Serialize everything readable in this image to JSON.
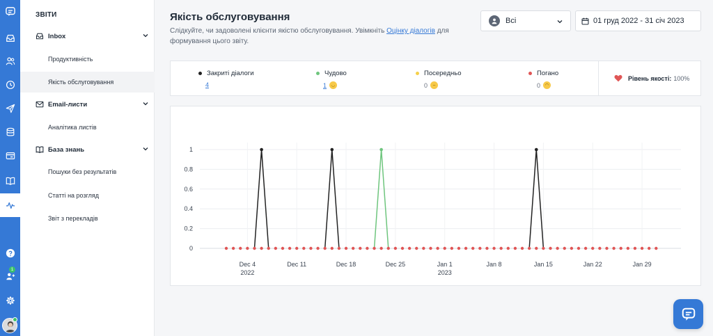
{
  "sidebar": {
    "heading": "ЗВІТИ",
    "groups": [
      {
        "label": "Inbox",
        "items": [
          "Продуктивність",
          "Якість обслуговування"
        ]
      },
      {
        "label": "Email-листи",
        "items": [
          "Аналітика листів"
        ]
      },
      {
        "label": "База знань",
        "items": [
          "Пошуки без результатів",
          "Статті на розгляд",
          "Звіт з перекладів"
        ]
      }
    ],
    "active_item": "Якість обслуговування"
  },
  "rail": {
    "icons": [
      "chat-logo-icon",
      "inbox-icon",
      "contacts-icon",
      "clock-icon",
      "send-icon",
      "database-icon",
      "card-icon",
      "book-icon",
      "reports-icon",
      "help-icon",
      "team-icon",
      "settings-icon"
    ],
    "team_badge": "1"
  },
  "header": {
    "title": "Якість обслуговування",
    "subtitle_before": "Слідкуйте, чи задоволені клієнти якістю обслуговування. Увімкніть ",
    "subtitle_link": "Оцінку діалогів",
    "subtitle_after": " для формування цього звіту."
  },
  "filters": {
    "agent": "Всі",
    "date_range": "01 груд 2022 - 31 січ 2023"
  },
  "stats": {
    "closed_label": "Закриті діалоги",
    "closed_value": "4",
    "great_label": "Чудово",
    "great_value": "1",
    "average_label": "Посередньо",
    "average_value": "0",
    "bad_label": "Погано",
    "bad_value": "0",
    "quality_label": "Рівень якості:",
    "quality_value": "100%"
  },
  "colors": {
    "accent": "#3579d6",
    "closed": "#222222",
    "great": "#6ec57d",
    "average": "#f5d04a",
    "bad": "#e05656"
  },
  "chart_data": {
    "type": "line",
    "ylim": [
      0,
      1
    ],
    "y_ticks": [
      "0",
      "0.2",
      "0.4",
      "0.6",
      "0.8",
      "1"
    ],
    "x_tick_labels": [
      "Dec 4",
      "Dec 11",
      "Dec 18",
      "Dec 25",
      "Jan 1",
      "Jan 8",
      "Jan 15",
      "Jan 22",
      "Jan 29"
    ],
    "x_year_labels": {
      "Dec 4": "2022",
      "Jan 1": "2023"
    },
    "x": [
      "2022-12-01",
      "2022-12-02",
      "2022-12-03",
      "2022-12-04",
      "2022-12-05",
      "2022-12-06",
      "2022-12-07",
      "2022-12-08",
      "2022-12-09",
      "2022-12-10",
      "2022-12-11",
      "2022-12-12",
      "2022-12-13",
      "2022-12-14",
      "2022-12-15",
      "2022-12-16",
      "2022-12-17",
      "2022-12-18",
      "2022-12-19",
      "2022-12-20",
      "2022-12-21",
      "2022-12-22",
      "2022-12-23",
      "2022-12-24",
      "2022-12-25",
      "2022-12-26",
      "2022-12-27",
      "2022-12-28",
      "2022-12-29",
      "2022-12-30",
      "2022-12-31",
      "2023-01-01",
      "2023-01-02",
      "2023-01-03",
      "2023-01-04",
      "2023-01-05",
      "2023-01-06",
      "2023-01-07",
      "2023-01-08",
      "2023-01-09",
      "2023-01-10",
      "2023-01-11",
      "2023-01-12",
      "2023-01-13",
      "2023-01-14",
      "2023-01-15",
      "2023-01-16",
      "2023-01-17",
      "2023-01-18",
      "2023-01-19",
      "2023-01-20",
      "2023-01-21",
      "2023-01-22",
      "2023-01-23",
      "2023-01-24",
      "2023-01-25",
      "2023-01-26",
      "2023-01-27",
      "2023-01-28",
      "2023-01-29",
      "2023-01-30",
      "2023-01-31"
    ],
    "series": [
      {
        "name": "Погано",
        "values": [
          0,
          0,
          0,
          0,
          0,
          0,
          0,
          0,
          0,
          0,
          0,
          0,
          0,
          0,
          0,
          0,
          0,
          0,
          0,
          0,
          0,
          0,
          0,
          0,
          0,
          0,
          0,
          0,
          0,
          0,
          0,
          0,
          0,
          0,
          0,
          0,
          0,
          0,
          0,
          0,
          0,
          0,
          0,
          0,
          0,
          0,
          0,
          0,
          0,
          0,
          0,
          0,
          0,
          0,
          0,
          0,
          0,
          0,
          0,
          0,
          0,
          0
        ]
      },
      {
        "name": "Посередньо",
        "values": [
          0,
          0,
          0,
          0,
          0,
          0,
          0,
          0,
          0,
          0,
          0,
          0,
          0,
          0,
          0,
          0,
          0,
          0,
          0,
          0,
          0,
          0,
          0,
          0,
          0,
          0,
          0,
          0,
          0,
          0,
          0,
          0,
          0,
          0,
          0,
          0,
          0,
          0,
          0,
          0,
          0,
          0,
          0,
          0,
          0,
          0,
          0,
          0,
          0,
          0,
          0,
          0,
          0,
          0,
          0,
          0,
          0,
          0,
          0,
          0,
          0,
          0
        ]
      },
      {
        "name": "Закриті діалоги",
        "values": [
          0,
          0,
          0,
          0,
          0,
          1,
          0,
          0,
          0,
          0,
          0,
          0,
          0,
          0,
          0,
          1,
          0,
          0,
          0,
          0,
          0,
          0,
          0,
          0,
          0,
          0,
          0,
          0,
          0,
          0,
          0,
          0,
          0,
          0,
          0,
          0,
          0,
          0,
          0,
          0,
          0,
          0,
          0,
          0,
          1,
          0,
          0,
          0,
          0,
          0,
          0,
          0,
          0,
          0,
          0,
          0,
          0,
          0,
          0,
          0,
          0,
          0
        ]
      },
      {
        "name": "Чудово",
        "values": [
          0,
          0,
          0,
          0,
          0,
          0,
          0,
          0,
          0,
          0,
          0,
          0,
          0,
          0,
          0,
          0,
          0,
          0,
          0,
          0,
          0,
          0,
          1,
          0,
          0,
          0,
          0,
          0,
          0,
          0,
          0,
          0,
          0,
          0,
          0,
          0,
          0,
          0,
          0,
          0,
          0,
          0,
          0,
          0,
          0,
          0,
          0,
          0,
          0,
          0,
          0,
          0,
          0,
          0,
          0,
          0,
          0,
          0,
          0,
          0,
          0,
          0
        ]
      }
    ],
    "grid": true,
    "legend": "none"
  }
}
